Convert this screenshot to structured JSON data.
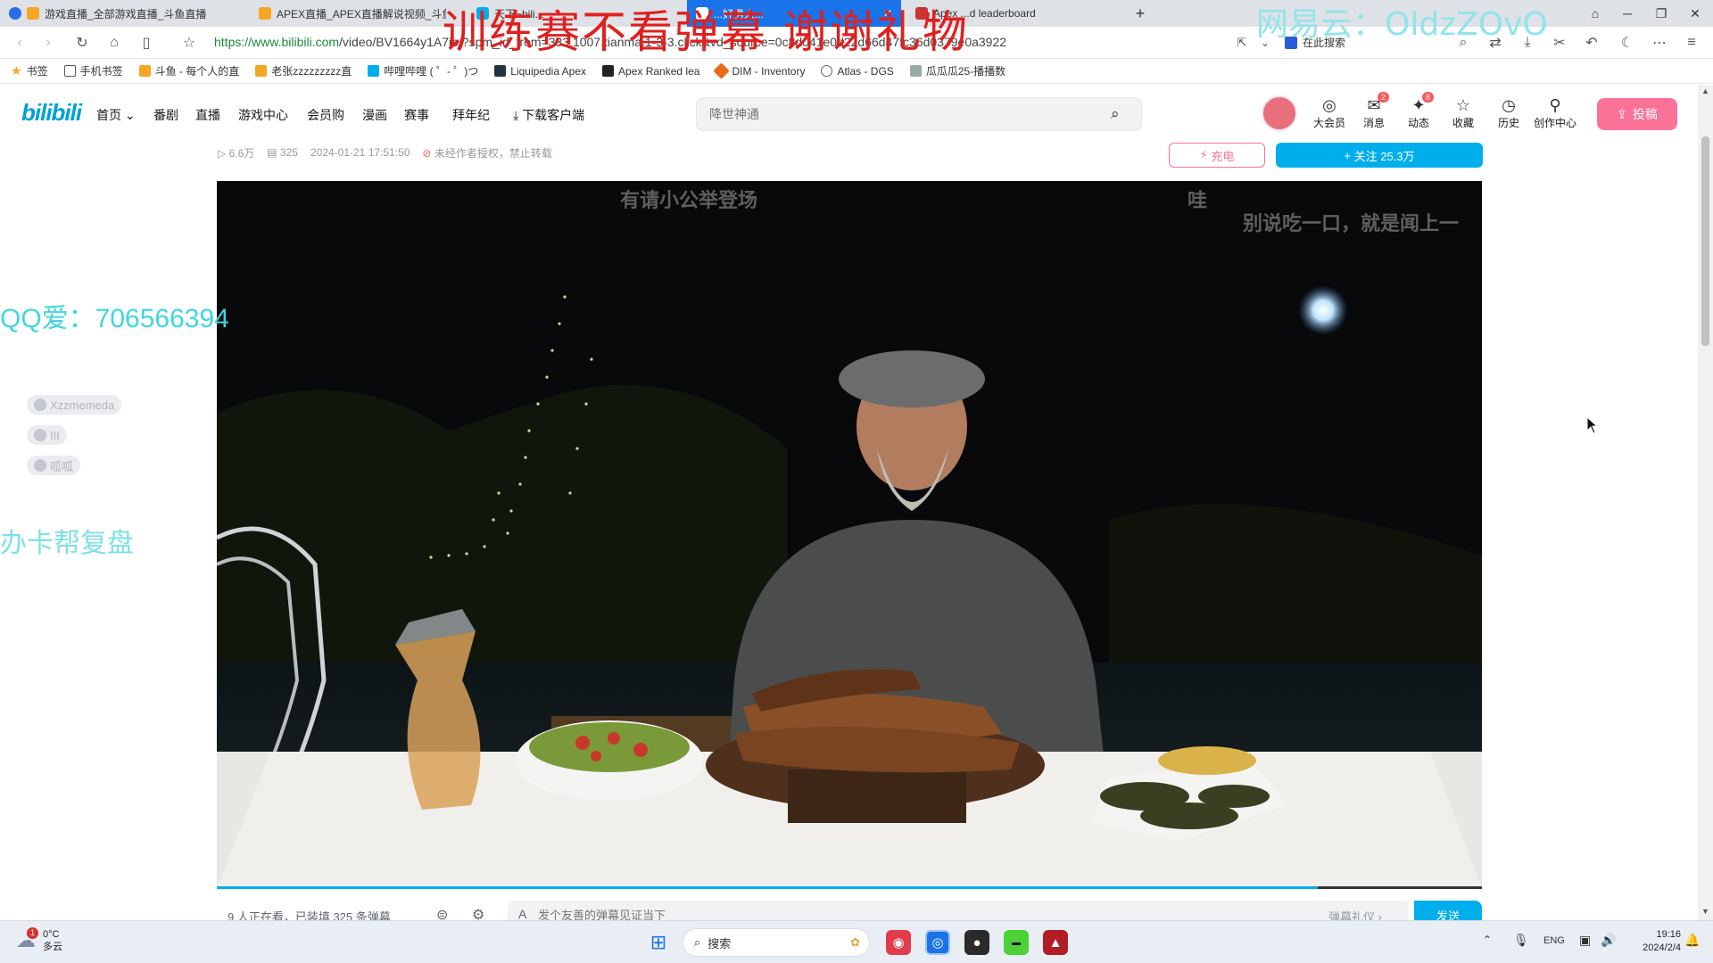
{
  "browser": {
    "tabs": [
      {
        "label": "游戏直播_全部游戏直播_斗鱼直播",
        "active": false
      },
      {
        "label": "APEX直播_APEX直播解说视频_斗鱼",
        "active": false
      },
      {
        "label": "天下~bili...",
        "active": false
      },
      {
        "label": "...好男人...",
        "active": true
      },
      {
        "label": "Apex ...d leaderboard",
        "active": false
      }
    ],
    "new_tab": "+",
    "url_domain": "https://www.bilibili.com",
    "url_path": "/video/BV1664y1A7ib/?spm_id_from=333.1007.tianma.1-3-3.click&vd_source=0c8d041e0d22d66d47fc36d0379e0a3922",
    "search_engine_label": "在此搜索",
    "bookmarks": [
      {
        "label": "书签",
        "icon": "star-icon"
      },
      {
        "label": "手机书签",
        "icon": "phone-icon"
      },
      {
        "label": "斗鱼 - 每个人的直",
        "icon": "douyu-icon"
      },
      {
        "label": "老张zzzzzzzzz直",
        "icon": "douyu-icon"
      },
      {
        "label": "哔哩哔哩 ( ゜- ゜)つ",
        "icon": "bilibili-icon"
      },
      {
        "label": "Liquipedia Apex",
        "icon": "liquipedia-icon"
      },
      {
        "label": "Apex Ranked lea",
        "icon": "apex-icon"
      },
      {
        "label": "DIM - Inventory",
        "icon": "dim-icon"
      },
      {
        "label": "Atlas - DGS",
        "icon": "globe-icon"
      },
      {
        "label": "瓜瓜瓜25-播播数",
        "icon": "site-icon"
      }
    ]
  },
  "site": {
    "logo": "bilibili",
    "nav": [
      "首页",
      "番剧",
      "直播",
      "游戏中心",
      "会员购",
      "漫画",
      "赛事",
      "拜年纪",
      "下载客户端"
    ],
    "search_placeholder": "降世神通",
    "right_nav": [
      {
        "label": "大会员",
        "icon": "vip-icon",
        "badge": ""
      },
      {
        "label": "消息",
        "icon": "message-icon",
        "badge": "2"
      },
      {
        "label": "动态",
        "icon": "dynamic-icon",
        "badge": "8"
      },
      {
        "label": "收藏",
        "icon": "star-icon",
        "badge": ""
      },
      {
        "label": "历史",
        "icon": "history-icon",
        "badge": ""
      },
      {
        "label": "创作中心",
        "icon": "bulb-icon",
        "badge": ""
      }
    ],
    "upload_label": "投稿"
  },
  "video": {
    "views": "6.6万",
    "danmaku_count": "325",
    "publish_time": "2024-01-21 17:51:50",
    "copyright_note": "未经作者授权，禁止转载",
    "charge_label": "充电",
    "follow_label": "关注 25.3万",
    "danmaku": [
      "有请小公举登场",
      "哇",
      "别说吃一口，就是闻上一"
    ],
    "progress": 0.87,
    "watching_text": "9 人正在看，已装填 325 条弹幕",
    "danmaku_placeholder": "发个友善的弹幕见证当下",
    "danmaku_etiquette": "弹幕礼仪 ›",
    "send_label": "发送"
  },
  "overlays": {
    "title": "训练赛不看弹幕 谢谢礼物",
    "netease": "网易云：OldzZOvO",
    "qq": "QQ爱：706566394",
    "card": "办卡帮复盘",
    "chips": [
      "Xzzmemeda",
      "III",
      "呱呱"
    ]
  },
  "taskbar": {
    "weather_temp": "0°C",
    "weather_desc": "多云",
    "weather_badge": "1",
    "search_label": "搜索",
    "lang": "ENG",
    "time": "19:16",
    "date": "2024/2/4"
  },
  "colors": {
    "bili_blue": "#00aeec",
    "bili_pink": "#fb7299",
    "overlay_red": "#e0201e",
    "overlay_cyan": "#3fd6e0"
  }
}
